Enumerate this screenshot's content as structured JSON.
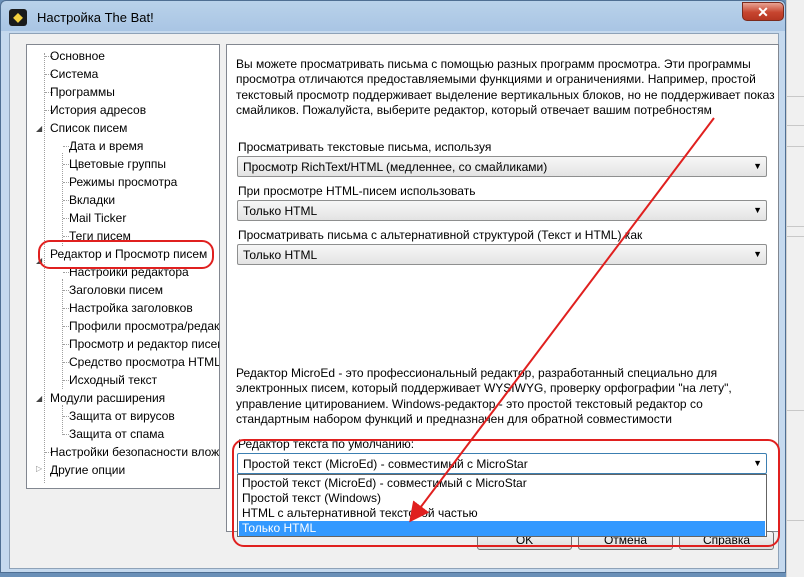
{
  "window": {
    "title": "Настройка The Bat!",
    "close_label": "✕"
  },
  "tree": {
    "items": [
      {
        "label": "Основное"
      },
      {
        "label": "Система"
      },
      {
        "label": "Программы"
      },
      {
        "label": "История адресов"
      },
      {
        "label": "Список писем"
      },
      {
        "label": "Дата и время"
      },
      {
        "label": "Цветовые группы"
      },
      {
        "label": "Режимы просмотра"
      },
      {
        "label": "Вкладки"
      },
      {
        "label": "Mail Ticker"
      },
      {
        "label": "Теги писем"
      },
      {
        "label": "Редактор и Просмотр писем"
      },
      {
        "label": "Настройки редактора"
      },
      {
        "label": "Заголовки писем"
      },
      {
        "label": "Настройка заголовков"
      },
      {
        "label": "Профили просмотра/редактора"
      },
      {
        "label": "Просмотр и редактор писем"
      },
      {
        "label": "Средство просмотра HTML"
      },
      {
        "label": "Исходный текст"
      },
      {
        "label": "Модули расширения"
      },
      {
        "label": "Защита от вирусов"
      },
      {
        "label": "Защита от спама"
      },
      {
        "label": "Настройки безопасности вложений"
      },
      {
        "label": "Другие опции"
      }
    ]
  },
  "main": {
    "intro": "Вы можете просматривать письма с помощью разных программ просмотра. Эти программы просмотра отличаются предоставляемыми функциями и ограничениями. Например, простой текстовый просмотр поддерживает выделение вертикальных блоков, но не поддерживает показ смайликов. Пожалуйста, выберите редактор, который отвечает вашим потребностям",
    "text_view_label": "Просматривать текстовые письма, используя",
    "text_view_value": "Просмотр RichText/HTML (медленнее, со смайликами)",
    "html_view_label": "При просмотре HTML-писем использовать",
    "html_view_value": "Только HTML",
    "alt_view_label": "Просматривать письма с альтернативной структурой (Текст и HTML) как",
    "alt_view_value": "Только HTML",
    "editor_desc": "Редактор MicroEd - это профессиональный редактор, разработанный специально для электронных писем, который поддерживает WYSIWYG, проверку орфографии \"на лету\", управление цитированием. Windows-редактор - это простой текстовый редактор со стандартным набором функций и предназначен для обратной совместимости",
    "default_editor_label": "Редактор текста по умолчанию:",
    "default_editor_value": "Простой текст (MicroEd)  - совместимый с MicroStar",
    "default_editor_options": [
      "Простой текст (MicroEd)  - совместимый с MicroStar",
      "Простой текст (Windows)",
      "HTML с альтернативной текстовой частью",
      "Только HTML"
    ]
  },
  "buttons": {
    "ok": "OK",
    "cancel": "Отмена",
    "help": "Справка"
  },
  "colors": {
    "highlight": "#e0201f",
    "selection": "#3399ff"
  }
}
